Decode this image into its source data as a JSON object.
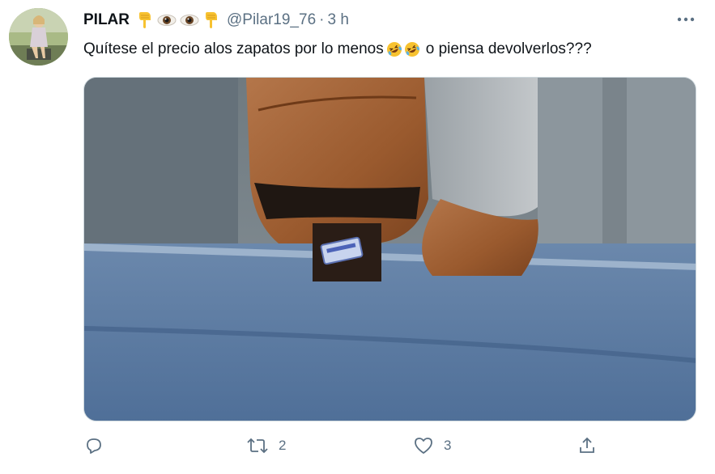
{
  "tweet": {
    "display_name": "PILAR",
    "handle": "@Pilar19_76",
    "separator": "·",
    "time": "3 h",
    "text_before": "Quítese el precio alos zapatos por lo menos",
    "text_after": "o piensa devolverlos???",
    "name_emojis": [
      "backhand-index-down-icon",
      "eye-icon",
      "eye-icon",
      "backhand-index-down-icon"
    ],
    "text_emojis": [
      "rolling-laughing-icon",
      "rolling-laughing-icon"
    ],
    "media": {
      "description_icon": "shoe-with-price-sticker-photo"
    }
  },
  "actions": {
    "reply_count": "",
    "retweet_count": "2",
    "like_count": "3"
  },
  "colors": {
    "text": "#0f1419",
    "secondary": "#5b7083",
    "border": "#cfd9de",
    "road": "#5e7ea4",
    "shoe": "#9a5a2e"
  }
}
